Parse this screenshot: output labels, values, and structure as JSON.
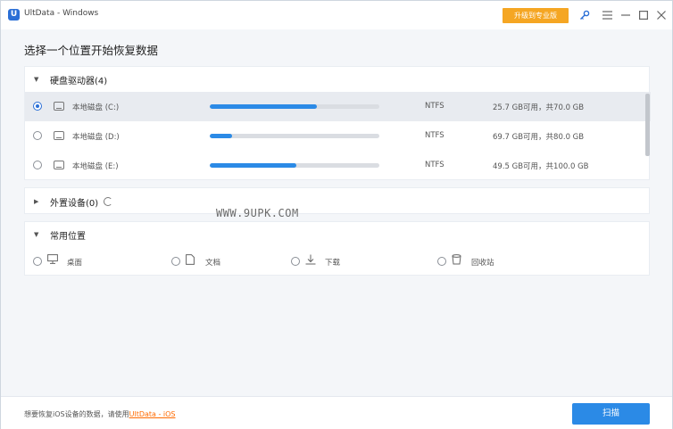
{
  "window": {
    "logo_letter": "U",
    "title": "UltData - Windows",
    "upgrade_label": "升级到专业版",
    "icons": [
      "key-icon",
      "menu-icon",
      "minimize-icon",
      "maximize-icon",
      "close-icon"
    ]
  },
  "page": {
    "title": "选择一个位置开始恢复数据"
  },
  "hard_drives": {
    "header": "硬盘驱动器(4)",
    "items": [
      {
        "name": "本地磁盘 (C:)",
        "fs": "NTFS",
        "capacity": "25.7 GB可用，共70.0 GB",
        "used_fraction": 0.63,
        "selected": true
      },
      {
        "name": "本地磁盘 (D:)",
        "fs": "NTFS",
        "capacity": "69.7 GB可用，共80.0 GB",
        "used_fraction": 0.13,
        "selected": false
      },
      {
        "name": "本地磁盘 (E:)",
        "fs": "NTFS",
        "capacity": "49.5 GB可用，共100.0 GB",
        "used_fraction": 0.51,
        "selected": false
      }
    ]
  },
  "external": {
    "header": "外置设备(0)"
  },
  "common": {
    "header": "常用位置",
    "items": [
      {
        "label": "桌面",
        "icon": "desktop-icon"
      },
      {
        "label": "文档",
        "icon": "document-icon"
      },
      {
        "label": "下载",
        "icon": "download-icon"
      },
      {
        "label": "回收站",
        "icon": "recycle-bin-icon"
      }
    ]
  },
  "watermark": "WWW.9UPK.COM",
  "footer": {
    "text": "想要恢复iOS设备的数据，请使用",
    "link": "UltData - iOS",
    "scan_label": "扫描"
  },
  "colors": {
    "accent": "#2b8ae6",
    "upgrade": "#f5a623",
    "link": "#ff6a00"
  }
}
